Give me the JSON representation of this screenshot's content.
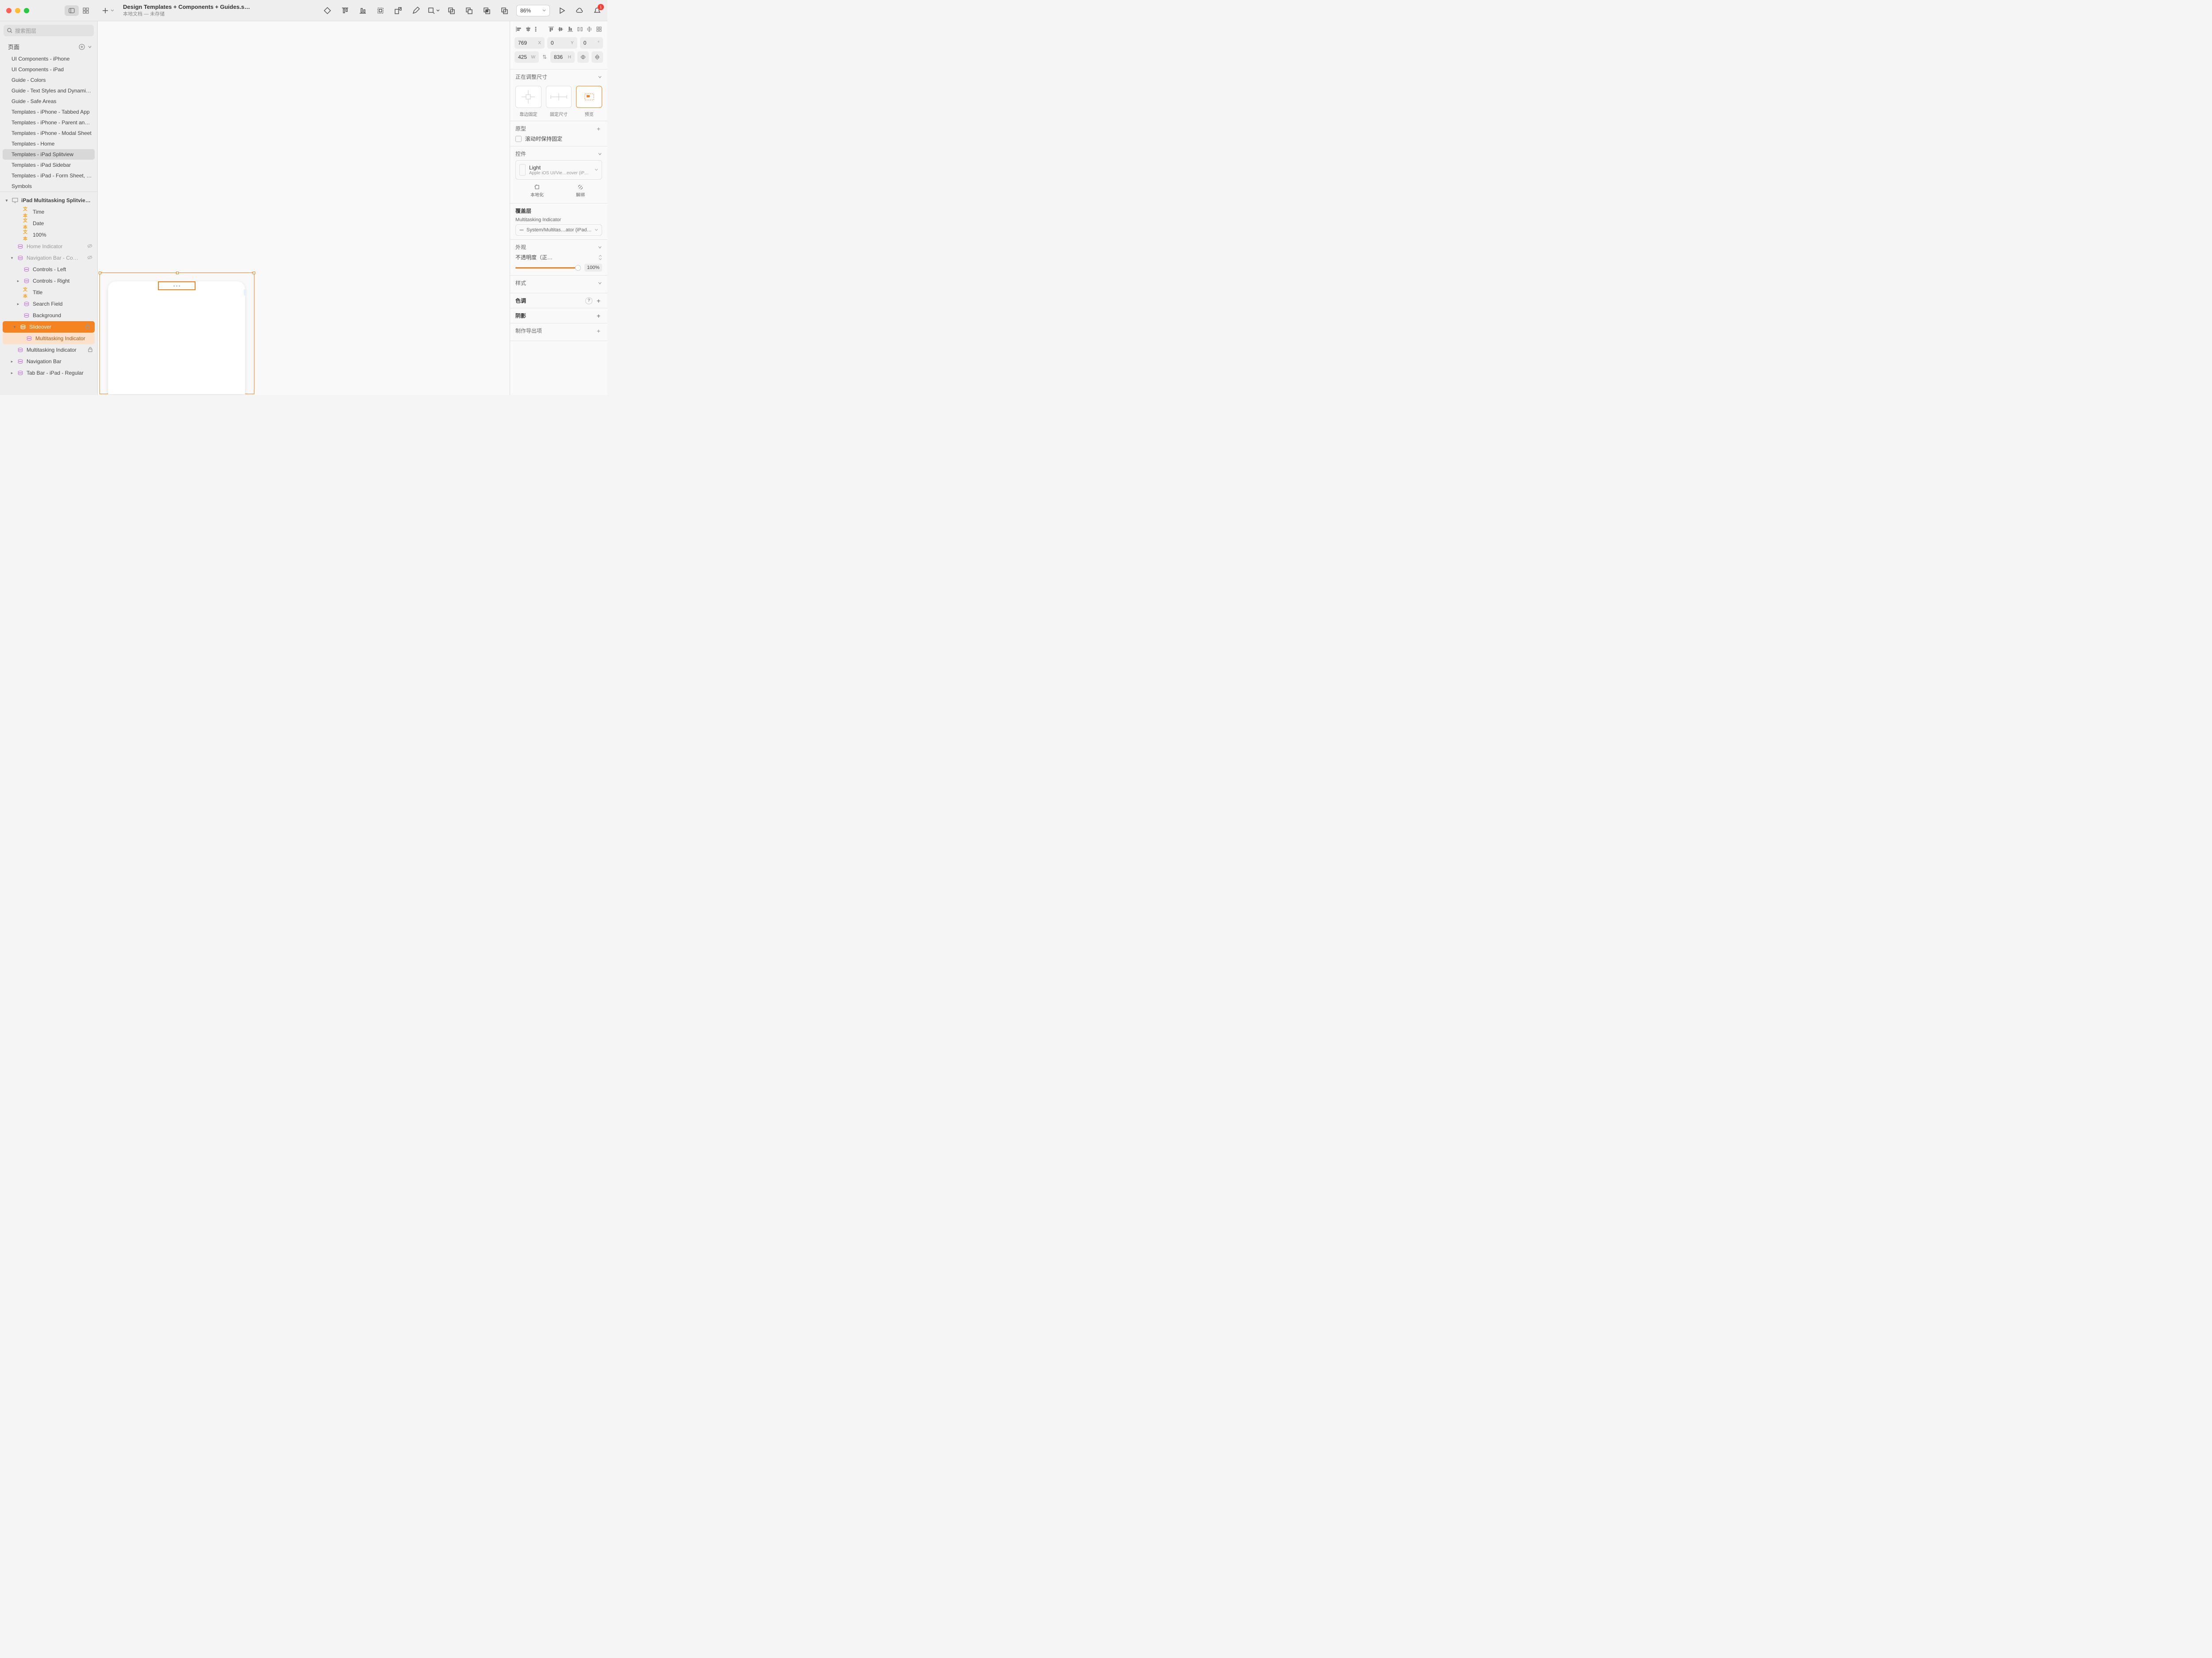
{
  "titlebar": {
    "doc_title": "Design Templates + Components + Guides.sk…",
    "doc_subtitle": "本地文档 — 未存储",
    "zoom": "86%",
    "notif_count": "1"
  },
  "sidebar": {
    "search_placeholder": "搜索图层",
    "pages_header": "页面",
    "pages": [
      "UI Components - iPhone",
      "UI Components - iPad",
      "Guide - Colors",
      "Guide - Text Styles and Dynamic…",
      "Guide - Safe Areas",
      "Templates - iPhone - Tabbed App",
      "Templates - iPhone - Parent and…",
      "Templates - iPhone - Modal Sheet",
      "Templates - Home",
      "Templates - iPad Splitview",
      "Templates - iPad Sidebar",
      "Templates - iPad - Form Sheet, Pa…",
      "Symbols"
    ],
    "selected_page_index": 9,
    "artboard_header": "iPad Multitasking Splitvie…",
    "layers": [
      {
        "indent": 2,
        "type": "text",
        "label": "Time"
      },
      {
        "indent": 2,
        "type": "text",
        "label": "Date"
      },
      {
        "indent": 2,
        "type": "text",
        "label": "100%"
      },
      {
        "indent": 1,
        "type": "symbol",
        "label": "Home Indicator",
        "grey": true,
        "hidden": true
      },
      {
        "indent": 1,
        "type": "symbol",
        "label": "Navigation Bar - Co…",
        "grey": true,
        "chev": "down",
        "hidden": true
      },
      {
        "indent": 2,
        "type": "symbol",
        "label": "Controls - Left"
      },
      {
        "indent": 2,
        "type": "symbol",
        "label": "Controls - Right",
        "chev": "right"
      },
      {
        "indent": 2,
        "type": "text",
        "label": "Title"
      },
      {
        "indent": 2,
        "type": "symbol",
        "label": "Search Field",
        "chev": "right"
      },
      {
        "indent": 2,
        "type": "symbol",
        "label": "Background"
      },
      {
        "indent": 1,
        "type": "symbol",
        "label": "Slideover",
        "chev": "down",
        "sel": "orange",
        "locked": true
      },
      {
        "indent": 2,
        "type": "symbol",
        "label": "Multitasking Indicator",
        "sel": "light"
      },
      {
        "indent": 1,
        "type": "symbol",
        "label": "Multitasking Indicator",
        "locked": true
      },
      {
        "indent": 1,
        "type": "symbol",
        "label": "Navigation Bar",
        "chev": "right"
      },
      {
        "indent": 1,
        "type": "symbol",
        "label": "Tab Bar - iPad - Regular",
        "chev": "right"
      }
    ]
  },
  "inspector": {
    "x": "769",
    "y": "0",
    "rot": "0",
    "w": "425",
    "h": "836",
    "resize_header": "正在调整尺寸",
    "resize_labels": [
      "靠边固定",
      "固定尺寸",
      "预览"
    ],
    "proto_header": "原型",
    "proto_checkbox": "滚动时保持固定",
    "controls_header": "控件",
    "symbol_name": "Light",
    "symbol_path": "Apple iOS UI/Vie…eover (iPad Only)/",
    "action_localize": "本地化",
    "action_unbind": "解绑",
    "overrides_header": "覆盖层",
    "override_name": "Multitasking Indicator",
    "override_value": "System/Multitas…ator (iPad)/Light",
    "appearance_header": "外观",
    "opacity_label": "不透明度（正…",
    "opacity_value": "100%",
    "styles_header": "样式",
    "tint_header": "色调",
    "shadow_header": "阴影",
    "export_header": "制作导出项"
  }
}
